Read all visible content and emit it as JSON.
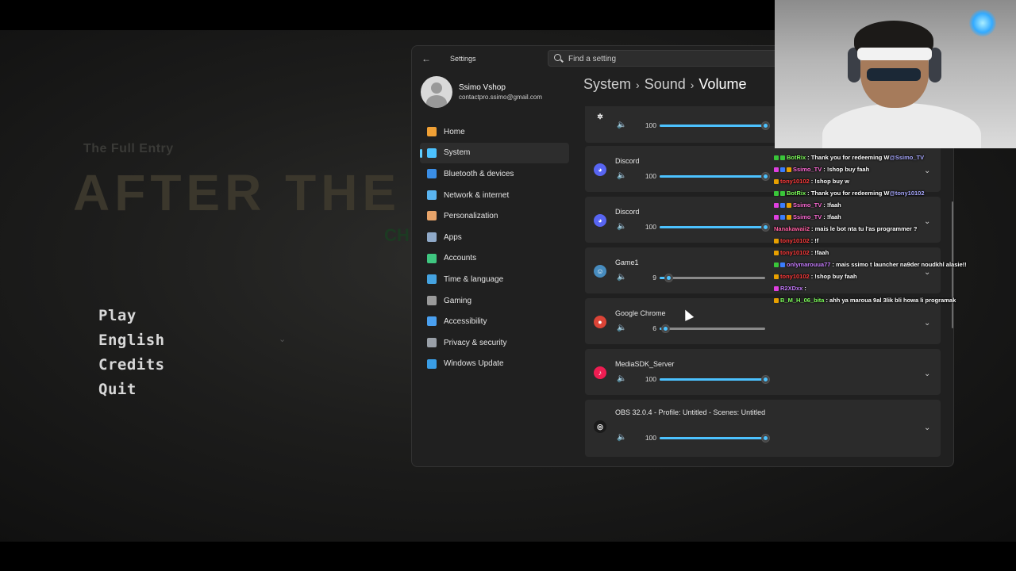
{
  "game": {
    "subtitle": "The Full Entry",
    "title": "AFTER THE TI",
    "title_fragment": "CH",
    "menu": [
      "Play",
      "English",
      "Credits",
      "Quit"
    ],
    "language_chevron": "⌄"
  },
  "settings": {
    "app_title": "Settings",
    "search_placeholder": "Find a setting",
    "profile": {
      "name": "Ssimo Vshop",
      "email": "contactpro.ssimo@gmail.com"
    },
    "nav": [
      {
        "label": "Home",
        "icon": "home-icon",
        "color": "#f0a035"
      },
      {
        "label": "System",
        "icon": "system-icon",
        "color": "#4cc2ff",
        "active": true
      },
      {
        "label": "Bluetooth & devices",
        "icon": "bluetooth-icon",
        "color": "#3a8ee6"
      },
      {
        "label": "Network & internet",
        "icon": "wifi-icon",
        "color": "#5ab4f0"
      },
      {
        "label": "Personalization",
        "icon": "brush-icon",
        "color": "#e8a46a"
      },
      {
        "label": "Apps",
        "icon": "apps-icon",
        "color": "#8fa9c8"
      },
      {
        "label": "Accounts",
        "icon": "accounts-icon",
        "color": "#3fc680"
      },
      {
        "label": "Time & language",
        "icon": "globe-icon",
        "color": "#45a3e0"
      },
      {
        "label": "Gaming",
        "icon": "gamepad-icon",
        "color": "#9a9a9a"
      },
      {
        "label": "Accessibility",
        "icon": "accessibility-icon",
        "color": "#4aa0f0"
      },
      {
        "label": "Privacy & security",
        "icon": "shield-icon",
        "color": "#9aa0a8"
      },
      {
        "label": "Windows Update",
        "icon": "update-icon",
        "color": "#3a9ee6"
      }
    ],
    "breadcrumb": [
      "System",
      "Sound",
      "Volume"
    ],
    "apps": [
      {
        "name": "",
        "icon": "steelseries-icon",
        "icon_bg": "#2b2b2b",
        "icon_fg": "#ffffff",
        "glyph": "✲",
        "volume": 100
      },
      {
        "name": "Discord",
        "icon": "discord-icon",
        "icon_bg": "#5865f2",
        "icon_fg": "#ffffff",
        "glyph": "◕",
        "volume": 100
      },
      {
        "name": "Discord",
        "icon": "discord-icon",
        "icon_bg": "#5865f2",
        "icon_fg": "#ffffff",
        "glyph": "◕",
        "volume": 100
      },
      {
        "name": "Game1",
        "icon": "godot-icon",
        "icon_bg": "#478cbf",
        "icon_fg": "#ffffff",
        "glyph": "☺",
        "volume": 9
      },
      {
        "name": "Google Chrome",
        "icon": "chrome-icon",
        "icon_bg": "#db4437",
        "icon_fg": "#ffffff",
        "glyph": "●",
        "volume": 6
      },
      {
        "name": "MediaSDK_Server",
        "icon": "tiktok-icon",
        "icon_bg": "#ee1d52",
        "icon_fg": "#ffffff",
        "glyph": "♪",
        "volume": 100
      },
      {
        "name": "OBS 32.0.4 - Profile: Untitled - Scenes: Untitled",
        "icon": "obs-icon",
        "icon_bg": "#1a1a1a",
        "icon_fg": "#ffffff",
        "glyph": "◎",
        "volume": 100
      }
    ]
  },
  "chat": [
    {
      "user": "BotRix",
      "user_color": "#7fff5c",
      "badges": [
        "#39c639",
        "#39c639"
      ],
      "msg": ": Thank you for redeeming W ",
      "mention": "@Ssimo_TV"
    },
    {
      "user": "Ssimo_TV",
      "user_color": "#ff6bd6",
      "badges": [
        "#e040e0",
        "#3a7dff",
        "#e8a000"
      ],
      "msg": ": !shop buy faah",
      "mention": ""
    },
    {
      "user": "tony10102",
      "user_color": "#ff3b3b",
      "badges": [
        "#e8a000"
      ],
      "msg": ": !shop buy w",
      "mention": ""
    },
    {
      "user": "BotRix",
      "user_color": "#7fff5c",
      "badges": [
        "#39c639",
        "#39c639"
      ],
      "msg": ": Thank you for redeeming W ",
      "mention": "@tony10102"
    },
    {
      "user": "Ssimo_TV",
      "user_color": "#ff6bd6",
      "badges": [
        "#e040e0",
        "#3a7dff",
        "#e8a000"
      ],
      "msg": ": !faah",
      "mention": ""
    },
    {
      "user": "Ssimo_TV",
      "user_color": "#ff6bd6",
      "badges": [
        "#e040e0",
        "#3a7dff",
        "#e8a000"
      ],
      "msg": ": !faah",
      "mention": ""
    },
    {
      "user": "Nanakawaii2",
      "user_color": "#ff5fa2",
      "badges": [],
      "msg": ": mais le bot nta tu l'as programmer ?",
      "mention": ""
    },
    {
      "user": "tony10102",
      "user_color": "#ff3b3b",
      "badges": [
        "#e8a000"
      ],
      "msg": ": !f",
      "mention": ""
    },
    {
      "user": "tony10102",
      "user_color": "#ff3b3b",
      "badges": [
        "#e8a000"
      ],
      "msg": ": !faah",
      "mention": ""
    },
    {
      "user": "onlymarouua77",
      "user_color": "#c77dff",
      "badges": [
        "#39c639",
        "#3a7dff"
      ],
      "msg": ": mais ssimo t launcher na9der noudkhl alasie!!",
      "mention": ""
    },
    {
      "user": "tony10102",
      "user_color": "#ff3b3b",
      "badges": [
        "#e8a000"
      ],
      "msg": ": !shop buy faah",
      "mention": ""
    },
    {
      "user": "R2XDxx",
      "user_color": "#c77dff",
      "badges": [
        "#e040e0"
      ],
      "msg": ": ",
      "mention": ""
    },
    {
      "user": "B_M_H_06_bita",
      "user_color": "#7fff5c",
      "badges": [
        "#e8a000"
      ],
      "msg": ": ahh ya maroua 9al 3lik bli howa li programak",
      "mention": ""
    }
  ]
}
